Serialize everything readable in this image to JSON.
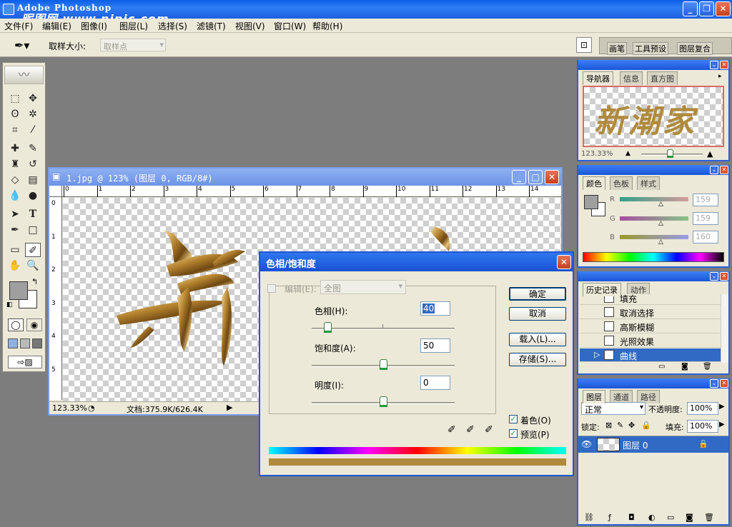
{
  "app": {
    "title": "Adobe Photoshop",
    "watermark": "昵图网 www.nipic.com"
  },
  "menu": [
    "文件(F)",
    "编辑(E)",
    "图像(I)",
    "图层(L)",
    "选择(S)",
    "滤镜(T)",
    "视图(V)",
    "窗口(W)",
    "帮助(H)"
  ],
  "options_bar": {
    "sample_size_label": "取样大小:",
    "sample_size_value": "取样点",
    "panel_well_tabs": [
      "画笔",
      "工具预设",
      "图层复合"
    ]
  },
  "document": {
    "title": "1.jpg @ 123% (图层 0, RGB/8#)",
    "zoom": "123.33%",
    "doc_info": "文档:375.9K/626.4K",
    "ruler_labels": [
      "0",
      "1",
      "2",
      "3",
      "4",
      "5",
      "6",
      "7",
      "8",
      "9",
      "10",
      "11",
      "12",
      "13",
      "14"
    ],
    "vruler_labels": [
      "0",
      "1",
      "2",
      "3",
      "4",
      "5"
    ]
  },
  "navigator_panel": {
    "tabs": [
      "导航器",
      "信息",
      "直方图"
    ],
    "zoom": "123.33%",
    "preview_text": "新潮家"
  },
  "color_panel": {
    "tabs": [
      "颜色",
      "色板",
      "样式"
    ],
    "channels": [
      {
        "label": "R",
        "value": "159"
      },
      {
        "label": "G",
        "value": "159"
      },
      {
        "label": "B",
        "value": "160"
      }
    ]
  },
  "history_panel": {
    "tabs": [
      "历史记录",
      "动作"
    ],
    "items": [
      "填充",
      "取消选择",
      "高斯模糊",
      "光照效果",
      "曲线"
    ]
  },
  "layers_panel": {
    "tabs": [
      "图层",
      "通道",
      "路径"
    ],
    "blend_mode": "正常",
    "opacity_label": "不透明度:",
    "opacity_value": "100%",
    "lock_label": "锁定:",
    "fill_label": "填充:",
    "fill_value": "100%",
    "layer_name": "图层 0"
  },
  "dialog": {
    "title": "色相/饱和度",
    "edit_label": "编辑(E):",
    "edit_value": "全图",
    "hue_label": "色相(H):",
    "hue_value": "40",
    "saturation_label": "饱和度(A):",
    "saturation_value": "50",
    "lightness_label": "明度(I):",
    "lightness_value": "0",
    "ok_label": "确定",
    "cancel_label": "取消",
    "load_label": "载入(L)...",
    "save_label": "存储(S)...",
    "colorize_label": "着色(O)",
    "preview_label": "预览(P)",
    "colorize_checked": true,
    "preview_checked": true
  },
  "colors": {
    "gold": "#b08a3c",
    "titlebar_blue": "#1c5fe0",
    "canvas_gray": "#7d7d7d"
  }
}
